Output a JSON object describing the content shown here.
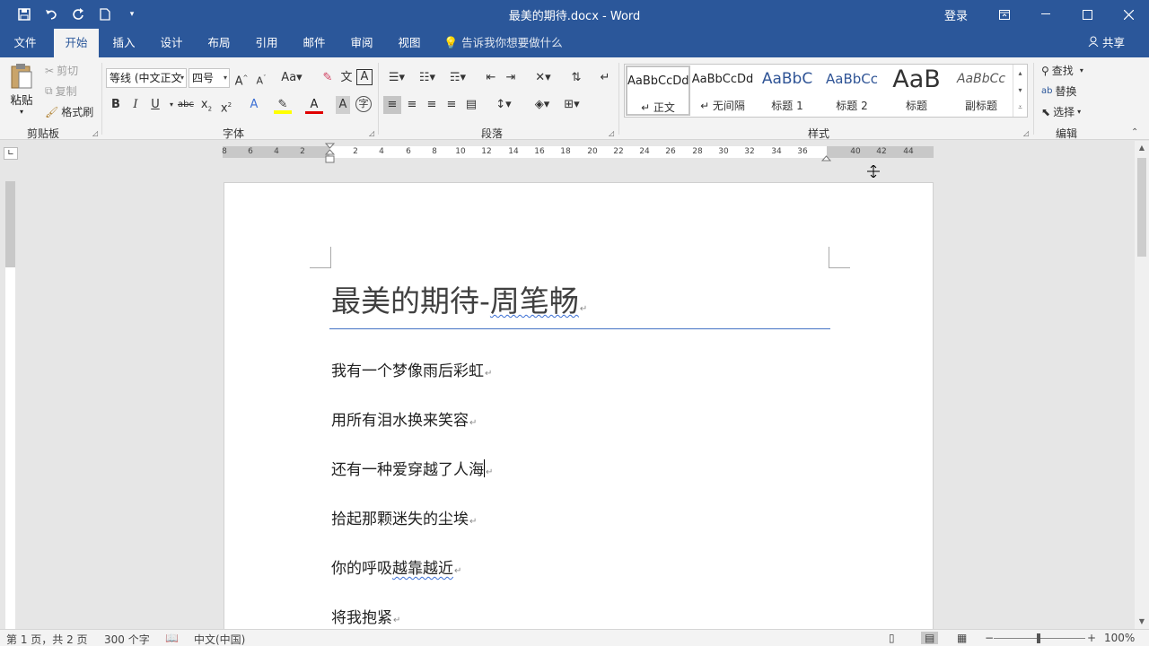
{
  "window": {
    "title": "最美的期待.docx - Word",
    "login_label": "登录"
  },
  "qat": {
    "save_icon": "save-icon",
    "undo_icon": "undo-icon",
    "redo_icon": "redo-icon",
    "new_icon": "new-document-icon"
  },
  "tabs": [
    {
      "label": "文件"
    },
    {
      "label": "开始"
    },
    {
      "label": "插入"
    },
    {
      "label": "设计"
    },
    {
      "label": "布局"
    },
    {
      "label": "引用"
    },
    {
      "label": "邮件"
    },
    {
      "label": "审阅"
    },
    {
      "label": "视图"
    }
  ],
  "tell_me": "告诉我你想要做什么",
  "share_label": "共享",
  "ribbon": {
    "clipboard": {
      "paste": "粘贴",
      "cut": "剪切",
      "copy": "复制",
      "format_painter": "格式刷",
      "label": "剪贴板"
    },
    "font": {
      "font_name": "等线 (中文正文",
      "font_size": "四号",
      "label": "字体"
    },
    "paragraph": {
      "label": "段落"
    },
    "styles": {
      "label": "样式",
      "items": [
        {
          "sample": "AaBbCcDd",
          "name": "↵ 正文"
        },
        {
          "sample": "AaBbCcDd",
          "name": "↵ 无间隔"
        },
        {
          "sample": "AaBbC",
          "name": "标题 1"
        },
        {
          "sample": "AaBbCc",
          "name": "标题 2"
        },
        {
          "sample": "AaB",
          "name": "标题"
        },
        {
          "sample": "AaBbCc",
          "name": "副标题"
        }
      ]
    },
    "editing": {
      "find": "查找",
      "replace": "替换",
      "select": "选择",
      "label": "编辑"
    }
  },
  "ruler": {
    "numbers": [
      "8",
      "6",
      "4",
      "2",
      "2",
      "4",
      "6",
      "8",
      "10",
      "12",
      "14",
      "16",
      "18",
      "20",
      "22",
      "24",
      "26",
      "28",
      "30",
      "32",
      "34",
      "36",
      "40",
      "42",
      "44"
    ]
  },
  "document": {
    "heading_main": "最美的期待-",
    "heading_name": "周笔畅",
    "paragraphs": [
      {
        "text": "我有一个梦像雨后彩虹"
      },
      {
        "text": "用所有泪水换来笑容"
      },
      {
        "text": "还有一种爱穿越了人海"
      },
      {
        "text": "拾起那颗迷失的尘埃"
      },
      {
        "pre": "你的呼吸",
        "squiggle": "越靠越近"
      },
      {
        "text": "将我抱紧"
      }
    ]
  },
  "status": {
    "page": "第 1 页，共 2 页",
    "words": "300 个字",
    "language": "中文(中国)",
    "zoom": "100%"
  }
}
